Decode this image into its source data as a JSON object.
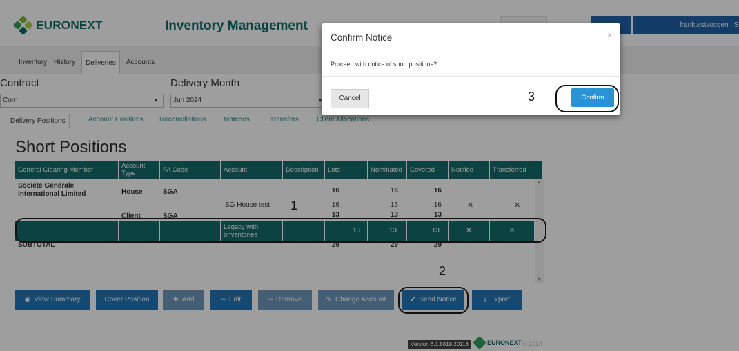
{
  "header": {
    "logo_text": "EURONEXT",
    "app_title": "Inventory Management",
    "user_text": "franktestsocgen | Soci"
  },
  "nav_tabs": [
    "Inventory",
    "History",
    "Deliveries",
    "Accounts"
  ],
  "active_nav_tab": "Deliveries",
  "filters": {
    "contract_label": "Contract",
    "contract_value": "Corn",
    "delivery_month_label": "Delivery Month",
    "delivery_month_value": "Jun 2024"
  },
  "sub_tabs": [
    "Delivery Positions",
    "Account Positions",
    "Reconciliations",
    "Matches",
    "Transfers",
    "Client Allocations"
  ],
  "active_sub_tab": "Delivery Positions",
  "section_title": "Short Positions",
  "table": {
    "columns": [
      "General Clearing Member",
      "Account Type",
      "FA Code",
      "Account",
      "Description",
      "Lots",
      "Nominated",
      "Covered",
      "Notified",
      "Transferred"
    ],
    "rows": [
      {
        "gcm": "Société Générale International Limited",
        "type": "House",
        "fa": "SGA",
        "account": "",
        "desc": "",
        "lots": "16",
        "nominated": "16",
        "covered": "16",
        "notified": "",
        "transferred": ""
      },
      {
        "gcm": "",
        "type": "",
        "fa": "",
        "account": "SG House test",
        "desc": "",
        "lots": "16",
        "nominated": "16",
        "covered": "16",
        "notified": "✕",
        "transferred": "✕"
      },
      {
        "gcm": "",
        "type": "Client",
        "fa": "SGA",
        "account": "",
        "desc": "",
        "lots": "13",
        "nominated": "13",
        "covered": "13",
        "notified": "",
        "transferred": ""
      },
      {
        "gcm": "",
        "type": "",
        "fa": "",
        "account": "Legacy with onventories",
        "desc": "",
        "lots": "13",
        "nominated": "13",
        "covered": "13",
        "notified": "✕",
        "transferred": "✕"
      },
      {
        "gcm": "SUBTOTAL",
        "type": "",
        "fa": "",
        "account": "",
        "desc": "",
        "lots": "29",
        "nominated": "29",
        "covered": "29",
        "notified": "",
        "transferred": ""
      }
    ]
  },
  "toolbar": {
    "view_summary": "View Summary",
    "cover_position": "Cover Position",
    "add": "Add",
    "edit": "Edit",
    "remove": "Remove",
    "change_account": "Change Account",
    "send_notice": "Send Notice",
    "export": "Export"
  },
  "footer": {
    "version": "Version 6.1.8819.20118",
    "logo_text": "EURONEXT",
    "copyright": "© 2024"
  },
  "modal": {
    "title": "Confirm Notice",
    "close_glyph": "×",
    "message": "Proceed with notice of short positions?",
    "cancel": "Cancel",
    "confirm": "Confirm"
  },
  "annotations": {
    "one": "1",
    "two": "2",
    "three": "3"
  },
  "colors": {
    "teal": "#146b6b",
    "button_blue": "#2277b9",
    "confirm_blue": "#2a93d6",
    "brand_green": "#0d6b69"
  },
  "icons": {
    "eye": "eye-icon",
    "plus": "plus-icon",
    "minus": "minus-icon",
    "pencil": "pencil-icon",
    "check": "check-icon",
    "download": "download-icon",
    "close": "close-icon",
    "chevron": "chevron-down-icon"
  }
}
